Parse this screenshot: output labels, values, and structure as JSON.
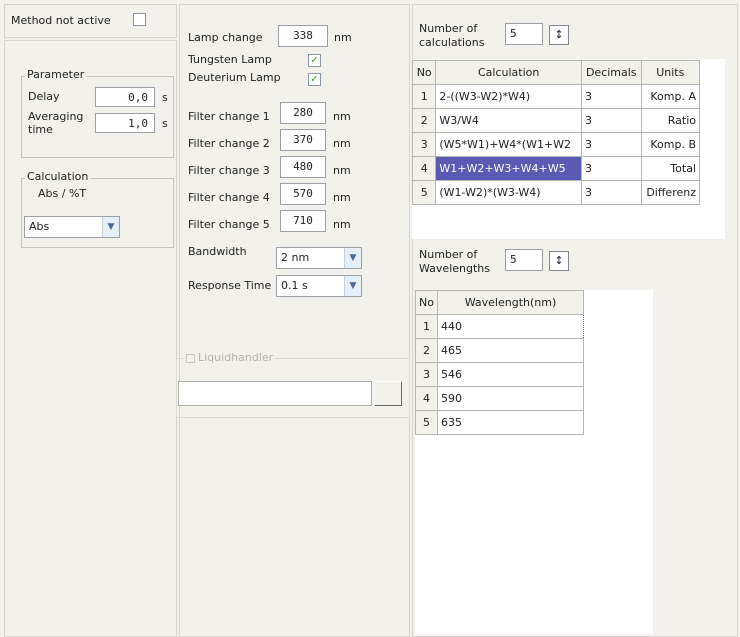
{
  "method_active": {
    "label": "Method not active"
  },
  "parameter": {
    "title": "Parameter",
    "delay": {
      "label": "Delay",
      "value": "0,0",
      "unit": "s"
    },
    "averaging": {
      "label_line1": "Averaging",
      "label_line2": "time",
      "value": "1,0",
      "unit": "s"
    }
  },
  "calculation_group": {
    "title": "Calculation",
    "subtitle": "Abs / %T",
    "selected": "Abs"
  },
  "lamp": {
    "change_label": "Lamp change",
    "change_value": "338",
    "unit": "nm",
    "tungsten_label": "Tungsten Lamp",
    "deuterium_label": "Deuterium Lamp"
  },
  "filters": [
    {
      "label": "Filter change 1",
      "value": "280",
      "unit": "nm"
    },
    {
      "label": "Filter change 2",
      "value": "370",
      "unit": "nm"
    },
    {
      "label": "Filter change 3",
      "value": "480",
      "unit": "nm"
    },
    {
      "label": "Filter change 4",
      "value": "570",
      "unit": "nm"
    },
    {
      "label": "Filter change 5",
      "value": "710",
      "unit": "nm"
    }
  ],
  "bandwidth": {
    "label": "Bandwidth",
    "value": "2 nm"
  },
  "response_time": {
    "label": "Response Time",
    "value": "0.1 s"
  },
  "liquidhandler": {
    "label": "Liquidhandler",
    "button": "..."
  },
  "calculations": {
    "count_label_line1": "Number of",
    "count_label_line2": "calculations",
    "count": "5",
    "columns": [
      "No",
      "Calculation",
      "Decimals",
      "Units"
    ],
    "rows": [
      {
        "no": "1",
        "calc": "2-((W3-W2)*W4)",
        "dec": "3",
        "units": "Komp. A"
      },
      {
        "no": "2",
        "calc": "W3/W4",
        "dec": "3",
        "units": "Ratio"
      },
      {
        "no": "3",
        "calc": "(W5*W1)+W4*(W1+W2",
        "dec": "3",
        "units": "Komp. B"
      },
      {
        "no": "4",
        "calc": "W1+W2+W3+W4+W5",
        "dec": "3",
        "units": "Total"
      },
      {
        "no": "5",
        "calc": "(W1-W2)*(W3-W4)",
        "dec": "3",
        "units": "Differenz"
      }
    ]
  },
  "wavelengths": {
    "count_label_line1": "Number of",
    "count_label_line2": "Wavelengths",
    "count": "5",
    "columns": [
      "No",
      "Wavelength(nm)"
    ],
    "rows": [
      {
        "no": "1",
        "value": "440"
      },
      {
        "no": "2",
        "value": "465"
      },
      {
        "no": "3",
        "value": "546"
      },
      {
        "no": "4",
        "value": "590"
      },
      {
        "no": "5",
        "value": "635"
      }
    ]
  }
}
